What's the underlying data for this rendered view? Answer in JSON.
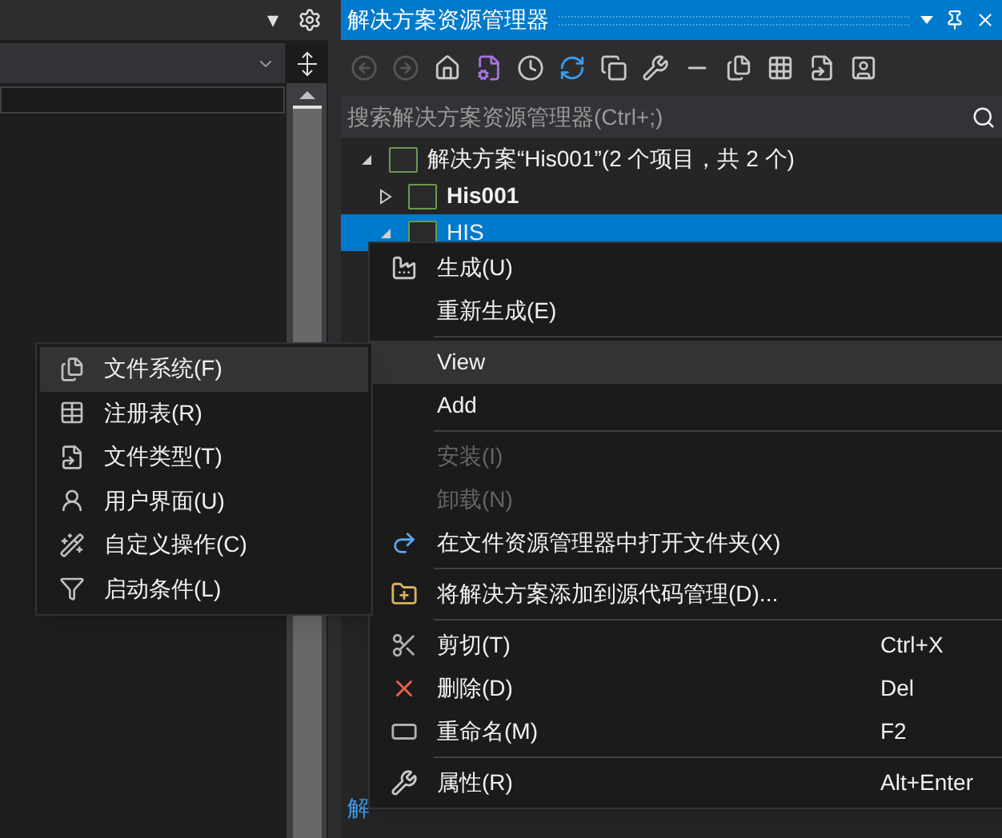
{
  "left_panel": {
    "header_caret": "▾"
  },
  "solution_explorer": {
    "title": "解决方案资源管理器",
    "search": {
      "placeholder": "搜索解决方案资源管理器(Ctrl+;)"
    },
    "tree": [
      {
        "label": "解决方案“His001”(2 个项目，共 2 个)",
        "bold": false,
        "selected": false,
        "expanded": true,
        "children": [
          {
            "label": "His001",
            "bold": true,
            "selected": false,
            "expanded": false
          },
          {
            "label": "HIS",
            "bold": false,
            "selected": true,
            "expanded": true
          }
        ]
      }
    ],
    "bottom_tab": "解"
  },
  "context_menu": [
    {
      "kind": "item",
      "label": "生成(U)",
      "disabled": false,
      "selected": false
    },
    {
      "kind": "item",
      "label": "重新生成(E)",
      "disabled": false,
      "selected": false
    },
    {
      "kind": "separator"
    },
    {
      "kind": "item",
      "label": "View",
      "disabled": false,
      "selected": true
    },
    {
      "kind": "item",
      "label": "Add",
      "disabled": false,
      "selected": false
    },
    {
      "kind": "separator"
    },
    {
      "kind": "item",
      "label": "安装(I)",
      "disabled": true,
      "selected": false
    },
    {
      "kind": "item",
      "label": "卸载(N)",
      "disabled": true,
      "selected": false
    },
    {
      "kind": "item",
      "label": "在文件资源管理器中打开文件夹(X)",
      "disabled": false,
      "selected": false
    },
    {
      "kind": "separator"
    },
    {
      "kind": "item",
      "label": "将解决方案添加到源代码管理(D)...",
      "disabled": false,
      "selected": false
    },
    {
      "kind": "separator"
    },
    {
      "kind": "item",
      "label": "剪切(T)",
      "shortcut": "Ctrl+X",
      "disabled": false,
      "selected": false
    },
    {
      "kind": "item",
      "label": "删除(D)",
      "shortcut": "Del",
      "disabled": false,
      "selected": false
    },
    {
      "kind": "item",
      "label": "重命名(M)",
      "shortcut": "F2",
      "disabled": false,
      "selected": false
    },
    {
      "kind": "separator"
    },
    {
      "kind": "item",
      "label": "属性(R)",
      "shortcut": "Alt+Enter",
      "disabled": false,
      "selected": false
    }
  ],
  "submenu": [
    {
      "label": "文件系统(F)",
      "selected": true
    },
    {
      "label": "注册表(R)",
      "selected": false
    },
    {
      "label": "文件类型(T)",
      "selected": false
    },
    {
      "label": "用户界面(U)",
      "selected": false
    },
    {
      "label": "自定义操作(C)",
      "selected": false
    },
    {
      "label": "启动条件(L)",
      "selected": false
    }
  ]
}
